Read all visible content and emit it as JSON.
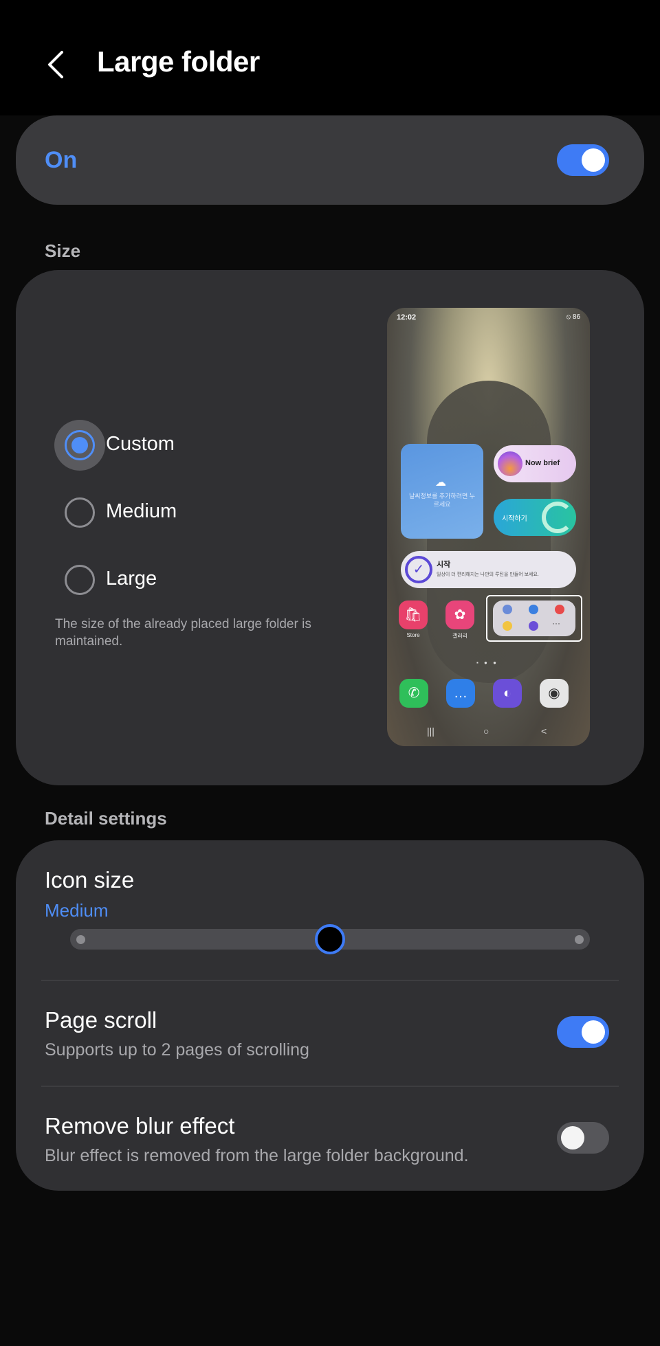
{
  "header": {
    "title": "Large folder",
    "back_icon": "chevron-left-icon"
  },
  "master_switch": {
    "label": "On",
    "state": true
  },
  "size_section": {
    "label": "Size",
    "options": [
      {
        "label": "Custom",
        "checked": true
      },
      {
        "label": "Medium",
        "checked": false
      },
      {
        "label": "Large",
        "checked": false
      }
    ],
    "note": "The size of the already placed large folder is maintained.",
    "preview": {
      "time": "12:02",
      "status": "⦸ 86",
      "widgets": {
        "weather_text": "날씨정보를 추가하려면 누르세요",
        "brief_label": "Now brief",
        "start_label": "시작하기",
        "goal_title": "시작",
        "goal_sub": "일상이 더 편리해지는 나만의 루틴을 만들어 보세요."
      },
      "apps": [
        {
          "label": "Store",
          "icon": "store-icon",
          "color": "#e8416b"
        },
        {
          "label": "갤러리",
          "icon": "gallery-icon",
          "color": "#e8457a"
        }
      ],
      "dock": [
        {
          "icon": "phone-icon",
          "color": "#2fbf5a",
          "glyph": "✆"
        },
        {
          "icon": "messages-icon",
          "color": "#2f7fe8",
          "glyph": "…"
        },
        {
          "icon": "internet-icon",
          "color": "#6b4fd8",
          "glyph": "◐"
        },
        {
          "icon": "camera-icon",
          "color": "#e6e6e6",
          "glyph": "◉"
        }
      ],
      "nav": [
        "|||",
        "○",
        "<"
      ],
      "folder_more": "···"
    }
  },
  "detail_section": {
    "label": "Detail settings",
    "icon_size": {
      "title": "Icon size",
      "value": "Medium",
      "level": 0.5
    },
    "page_scroll": {
      "title": "Page scroll",
      "subtitle": "Supports up to 2 pages of scrolling",
      "state": true
    },
    "blur": {
      "title": "Remove blur effect",
      "subtitle": "Blur effect is removed from the large folder background.",
      "state": false
    }
  },
  "colors": {
    "accent": "#4f8ef7",
    "toggle_on": "#3e7bf5",
    "card": "#303033",
    "background": "#0a0a0a"
  }
}
